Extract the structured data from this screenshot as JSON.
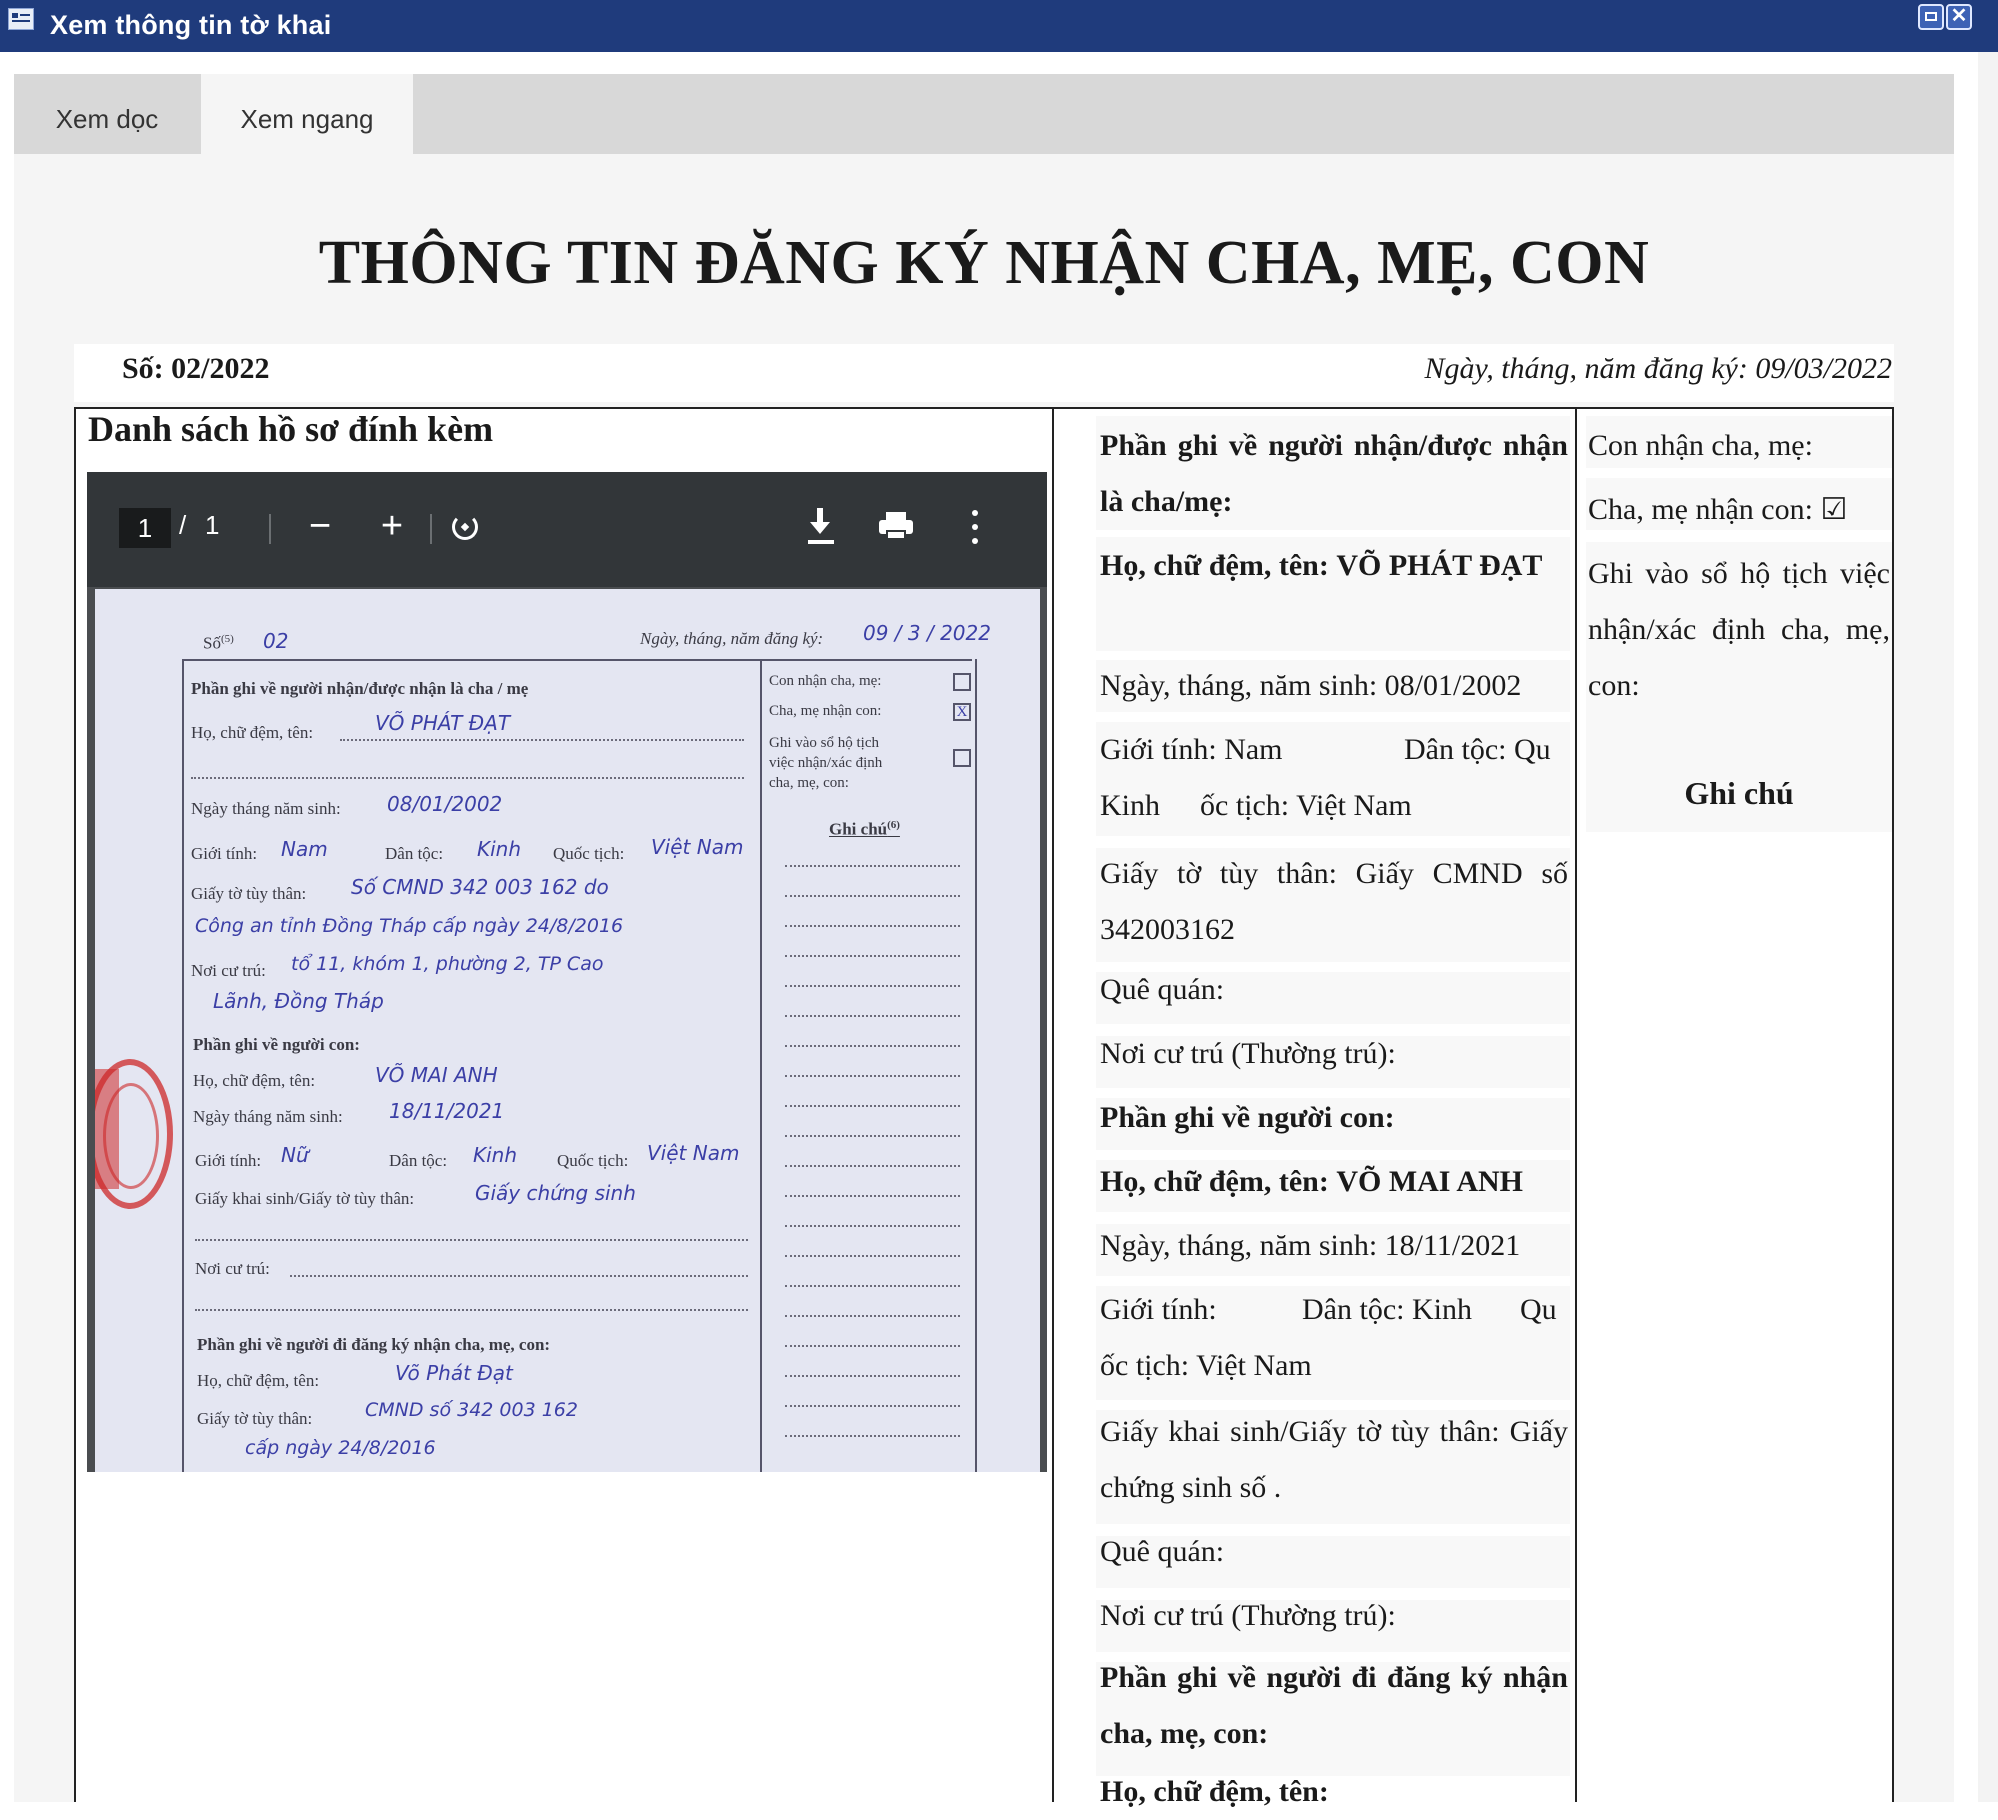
{
  "window": {
    "title": "Xem thông tin tờ khai"
  },
  "tabs": [
    {
      "label": "Xem dọc"
    },
    {
      "label": "Xem ngang"
    }
  ],
  "document": {
    "title": "THÔNG TIN ĐĂNG KÝ NHẬN CHA, MẸ, CON",
    "so_label": "Số: 02/2022",
    "date_label": "Ngày, tháng, năm đăng ký:  09/03/2022",
    "attachments_heading": "Danh sách hồ sơ đính kèm",
    "pdf_viewer": {
      "current_page": "1",
      "separator": "/",
      "total_pages": "1",
      "zoom_out": "−",
      "zoom_in": "+"
    },
    "scan": {
      "so": "Số",
      "so_sup": "(5)",
      "so_val": "02",
      "ngay_label": "Ngày, tháng, năm đăng ký:",
      "ngay_val": "09 / 3 / 2022",
      "sec1": "Phần ghi về người nhận/được nhận là cha / mẹ",
      "ho_ten_label": "Họ, chữ đệm, tên:",
      "ho_ten_val": "VÕ   PHÁT   ĐẠT",
      "ngay_sinh_label": "Ngày tháng năm sinh:",
      "ngay_sinh_val": "08/01/2002",
      "gioi_tinh_label": "Giới tính:",
      "gioi_tinh_val": "Nam",
      "dan_toc_label": "Dân tộc:",
      "dan_toc_val": "Kinh",
      "quoc_tich_label": "Quốc tịch:",
      "quoc_tich_val": "Việt Nam",
      "giay_to_label": "Giấy tờ tùy thân:",
      "giay_to_val": "Số CMND 342 003 162 do",
      "giay_to_val2": "Công an tỉnh Đồng Tháp cấp ngày 24/8/2016",
      "noi_cu_tru_label": "Nơi cư trú:",
      "noi_cu_tru_val": "tổ 11, khóm 1, phường 2, TP Cao",
      "noi_cu_tru_val2": "Lãnh, Đồng Tháp",
      "sec2": "Phần ghi về người con:",
      "con_ho_ten_val": "VÕ   MAI   ANH",
      "con_ngay_sinh_val": "18/11/2021",
      "con_gioi_tinh_val": "Nữ",
      "con_dan_toc_val": "Kinh",
      "con_quoc_tich_val": "Việt Nam",
      "khai_sinh_label": "Giấy khai sinh/Giấy tờ tùy thân:",
      "khai_sinh_val": "Giấy   chứng   sinh",
      "sec3": "Phần ghi về người đi đăng ký nhận cha, mẹ, con:",
      "dk_ho_ten_val": "Võ   Phát   Đạt",
      "dk_giay_to_val": "CMND số 342 003 162",
      "dk_giay_to_val2": "cấp ngày 24/8/2016",
      "right_con": "Con nhận cha, mẹ:",
      "right_cha": "Cha, mẹ nhận con:",
      "right_ghi": "Ghi vào sổ hộ tịch",
      "right_ghi2": "việc nhận/xác định",
      "right_ghi3": "cha, mẹ, con:",
      "ghi_chu": "Ghi chú",
      "ghi_chu_sup": "(6)",
      "check_mark": "X"
    },
    "col2": {
      "sec_parent": "Phần ghi về người nhận/được nhận là cha/mẹ:",
      "ho_ten_label": "Họ, chữ đệm, tên:",
      "ho_ten_val": "VÕ PHÁT ĐẠT",
      "ngay_sinh": "Ngày, tháng, năm sinh: 08/01/2002",
      "gioi_tinh_line": "Giới tính: Nam",
      "dan_toc_line": "Dân tộc: Qu",
      "kinh_line": "Kinh",
      "quoc_tich_line": "ốc tịch:  Việt Nam",
      "giay_to": "Giấy tờ tùy thân: Giấy CMND số 342003162",
      "que_quan": "Quê quán:",
      "noi_cu_tru": "Nơi cư trú (Thường trú):",
      "sec_child": "Phần ghi về người con:",
      "con_ho_ten_label": "Họ, chữ đệm, tên:",
      "con_ho_ten_val": "VÕ MAI ANH",
      "con_ngay_sinh": "Ngày, tháng, năm sinh: 18/11/2021",
      "con_gioi_tinh": "Giới tính:",
      "con_dan_toc": "Dân tộc: Kinh",
      "con_qu": "Qu",
      "con_quoc_tich": "ốc tịch:  Việt Nam",
      "khai_sinh": "Giấy khai sinh/Giấy tờ tùy thân: Giấy chứng sinh số .",
      "con_que_quan": "Quê quán:",
      "con_noi_cu_tru": "Nơi cư trú (Thường trú):",
      "sec_reg": "Phần ghi về người đi đăng ký nhận cha, mẹ, con:",
      "reg_ho_ten": "Họ, chữ đệm, tên:"
    },
    "col3": {
      "con_nhan": "Con nhận cha, mẹ:",
      "cha_nhan": "Cha, mẹ nhận con: ☑",
      "ghi_vao": "Ghi vào sổ hộ tịch việc nhận/xác định cha, mẹ, con:",
      "ghi_chu": "Ghi chú"
    }
  }
}
